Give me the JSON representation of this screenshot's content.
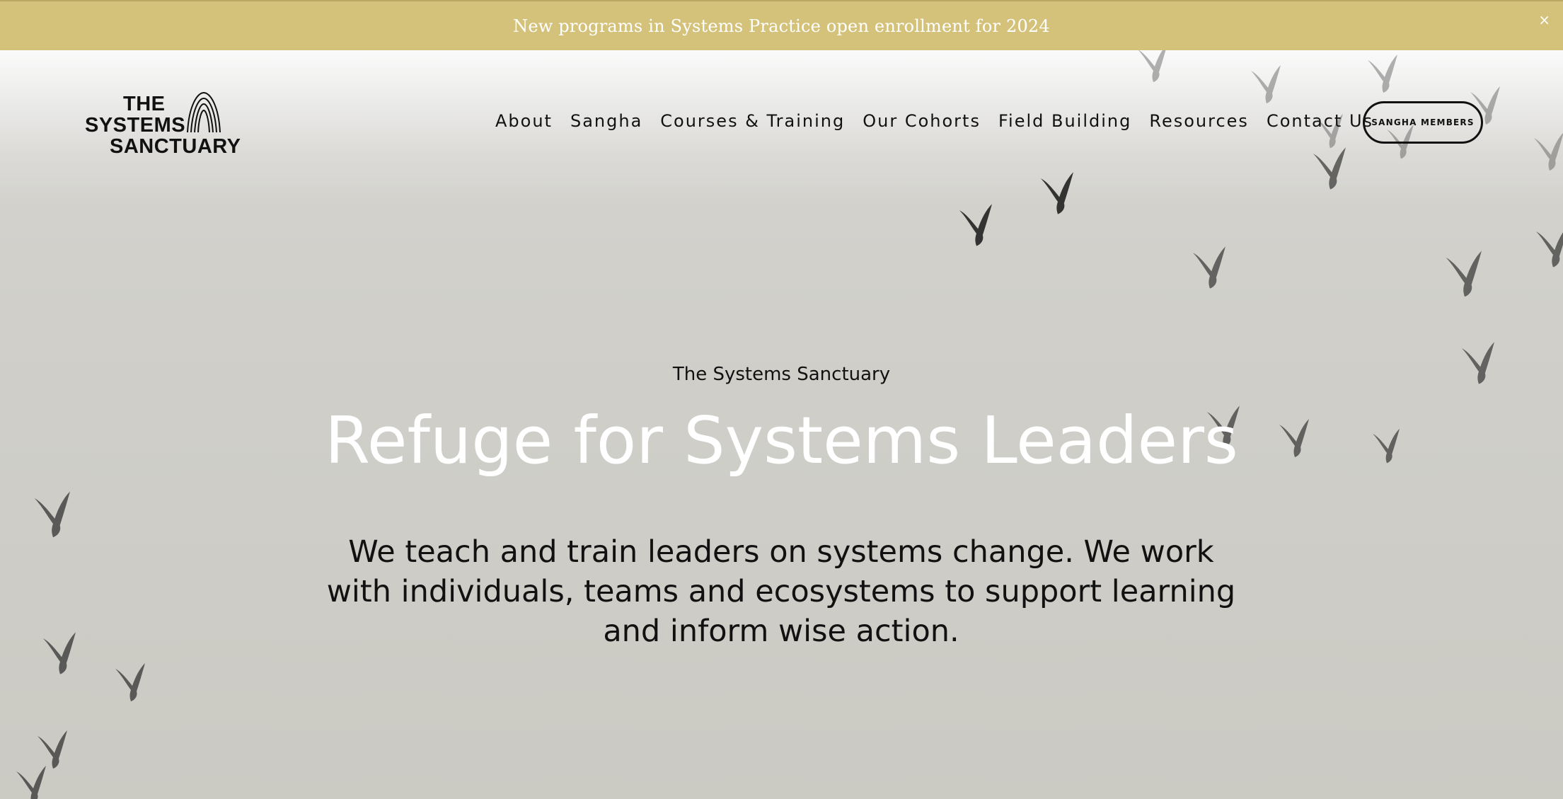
{
  "announcement": {
    "text": "New programs in Systems Practice open enrollment for 2024",
    "close_label": "×"
  },
  "logo": {
    "line1": "THE",
    "line2": "SYSTEMS",
    "line3": "SANCTUARY"
  },
  "nav": {
    "items": [
      {
        "label": "About"
      },
      {
        "label": "Sangha"
      },
      {
        "label": "Courses & Training"
      },
      {
        "label": "Our Cohorts"
      },
      {
        "label": "Field Building"
      },
      {
        "label": "Resources"
      },
      {
        "label": "Contact Us"
      }
    ],
    "members_button": "SANGHA MEMBERS"
  },
  "hero": {
    "eyebrow": "The Systems Sanctuary",
    "headline": "Refuge for Systems Leaders",
    "intro": "We teach and train leaders on systems change. We work with individuals, teams and ecosystems to support learning and inform wise action."
  },
  "colors": {
    "announcement_bg": "#d4c27b",
    "hero_bg": "#d0cfca",
    "text_dark": "#111111",
    "headline": "#ffffff"
  }
}
